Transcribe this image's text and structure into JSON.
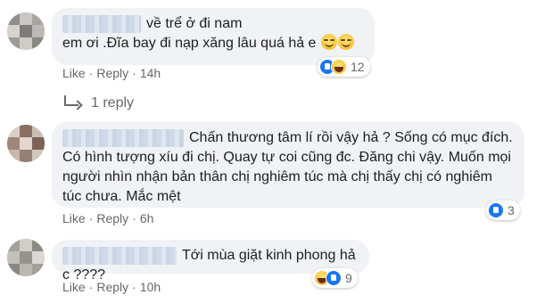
{
  "comments": [
    {
      "text_line1": "về trể ở đi nam",
      "text_line2": "em ơi .Đĩa bay đi nạp xăng lâu quá hả e",
      "like_label": "Like",
      "reply_label": "Reply",
      "time": "14h",
      "reaction_count": "12"
    },
    {
      "text": "Chấn thương tâm lí rồi vậy hả ? Sống có mục đích. Có hình tượng xíu đi chị. Quay tự coi cũng đc. Đăng chi vậy. Muốn mọi người nhìn nhận bản thân chị nghiêm túc mà chị thấy chị có nghiêm túc chưa. Mắc mệt",
      "like_label": "Like",
      "reply_label": "Reply",
      "time": "6h",
      "reaction_count": "3"
    },
    {
      "text": "Tới mùa giặt kinh phong hả c ????",
      "like_label": "Like",
      "reply_label": "Reply",
      "time": "10h",
      "reaction_count": "9"
    }
  ],
  "reply_thread_label": "1 reply",
  "colors": {
    "bubble": "#f0f2f5",
    "meta_text": "#65676b",
    "like_blue": "#1877f2"
  }
}
